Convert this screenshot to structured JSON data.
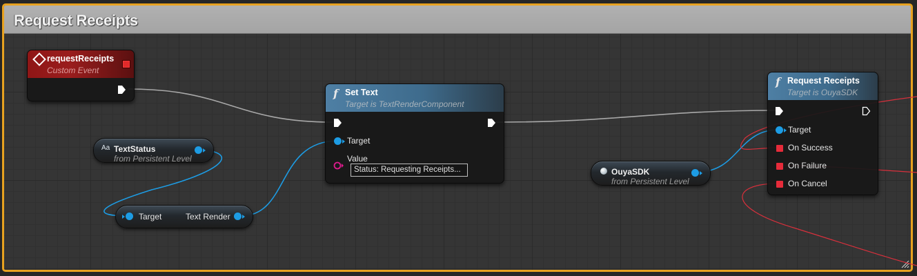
{
  "comment": {
    "title": "Request Receipts"
  },
  "nodes": {
    "event": {
      "title": "requestReceipts",
      "subtitle": "Custom Event"
    },
    "set_text": {
      "title": "Set Text",
      "subtitle": "Target is TextRenderComponent",
      "target_label": "Target",
      "value_label": "Value",
      "value": "Status: Requesting Receipts..."
    },
    "text_status": {
      "title": "TextStatus",
      "subtitle": "from Persistent Level",
      "type_glyph": "Aa"
    },
    "get_text_render": {
      "target_label": "Target",
      "output_label": "Text Render"
    },
    "ouya_sdk": {
      "title": "OuyaSDK",
      "subtitle": "from Persistent Level"
    },
    "request_receipts": {
      "title": "Request Receipts",
      "subtitle": "Target is OuyaSDK",
      "target_label": "Target",
      "success_label": "On Success",
      "failure_label": "On Failure",
      "cancel_label": "On Cancel"
    }
  },
  "colors": {
    "comment_border": "#e8a21f",
    "object_pin": "#1d9ce4",
    "delegate_pin": "#e62b3a",
    "string_pin": "#e01a8e",
    "exec_wire": "#c8c8c8",
    "event_header": "#9a1d1d",
    "function_header": "#4e7fa4"
  },
  "icons": {
    "function": "function-icon",
    "event": "event-diamond-icon",
    "exec": "exec-pin-icon",
    "object": "object-pin-icon",
    "delegate": "delegate-pin-icon"
  }
}
